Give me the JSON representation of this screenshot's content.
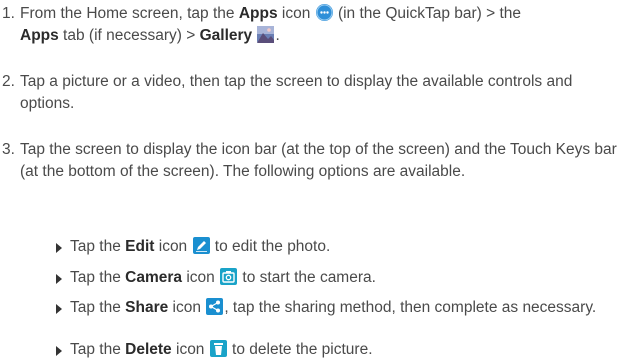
{
  "steps": [
    {
      "number": "1.",
      "parts": {
        "a": "From the Home screen, tap the ",
        "b": "Apps",
        "c": " icon ",
        "d": " (in the QuickTap bar) > the ",
        "e": "Apps",
        "f": " tab (if necessary) > ",
        "g": "Gallery",
        "h": "."
      }
    },
    {
      "number": "2.",
      "text": "Tap a picture or a video, then tap the screen to display the available controls and options."
    },
    {
      "number": "3.",
      "text": "Tap the screen to display the icon bar (at the top of the screen) and the Touch Keys bar (at the bottom of the screen). The following options are available."
    }
  ],
  "bullets": [
    {
      "pre": "Tap the ",
      "bold": "Edit",
      "mid": " icon ",
      "post": " to edit the photo.",
      "icon": "edit-icon"
    },
    {
      "pre": "Tap the ",
      "bold": "Camera",
      "mid": " icon ",
      "post": " to start the camera.",
      "icon": "camera-icon"
    },
    {
      "pre": "Tap the ",
      "bold": "Share",
      "mid": " icon ",
      "post": ", tap the sharing method, then complete as necessary.",
      "icon": "share-icon"
    },
    {
      "pre": "Tap the ",
      "bold": "Delete",
      "mid": " icon ",
      "post": " to delete the picture.",
      "icon": "delete-icon"
    }
  ],
  "colors": {
    "text": "#4a4a4a",
    "icon_blue": "#2f8fd8",
    "icon_teal": "#1aa3c8"
  }
}
